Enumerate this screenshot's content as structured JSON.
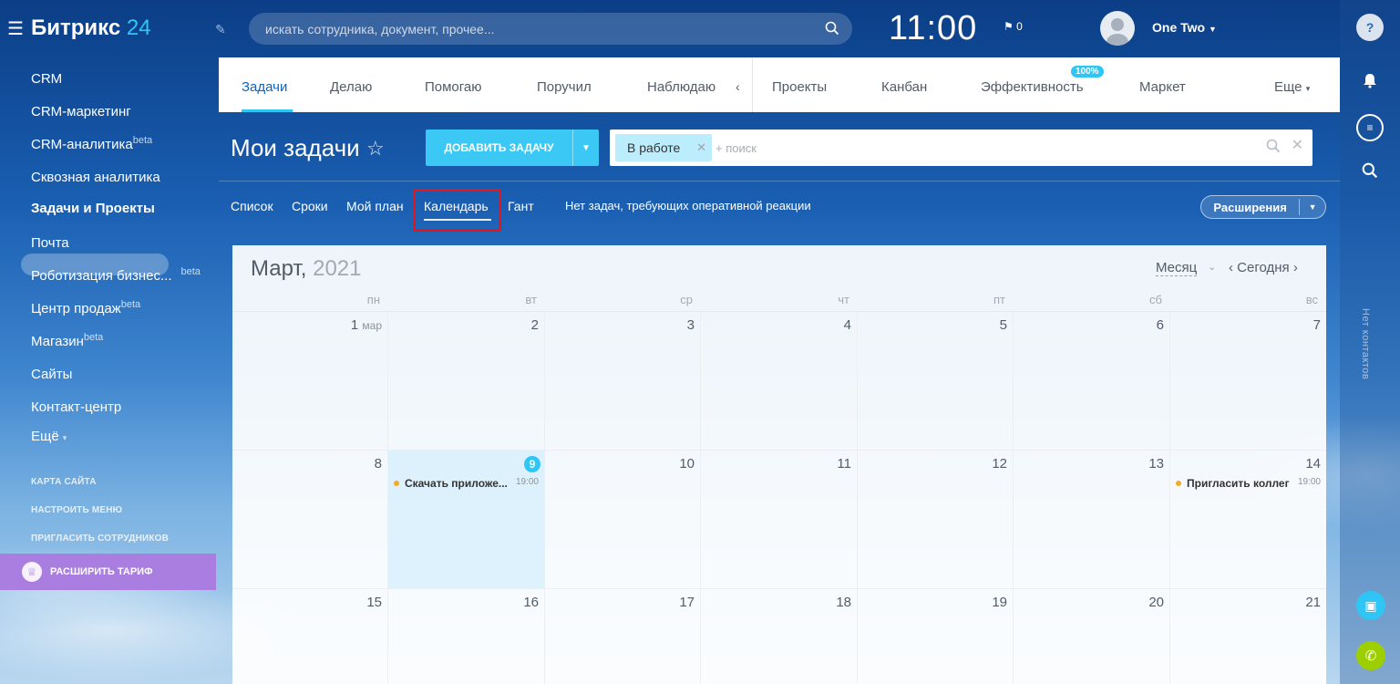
{
  "header": {
    "logo_main": "Битрикс",
    "logo_num": "24",
    "search_placeholder": "искать сотрудника, документ, прочее...",
    "clock": "11:00",
    "flag_count": "0",
    "user_name": "One Two"
  },
  "sidebar": {
    "items": [
      {
        "label": "CRM",
        "sup": ""
      },
      {
        "label": "CRM-маркетинг",
        "sup": ""
      },
      {
        "label": "CRM-аналитика",
        "sup": "beta"
      },
      {
        "label": "Сквозная аналитика",
        "sup": ""
      },
      {
        "label": "Задачи и Проекты",
        "sup": ""
      },
      {
        "label": "Почта",
        "sup": ""
      },
      {
        "label": "Роботизация бизнес...",
        "sup": "beta"
      },
      {
        "label": "Центр продаж",
        "sup": "beta"
      },
      {
        "label": "Магазин",
        "sup": "beta"
      },
      {
        "label": "Сайты",
        "sup": ""
      },
      {
        "label": "Контакт-центр",
        "sup": ""
      },
      {
        "label": "Ещё",
        "sup": ""
      }
    ],
    "links": [
      "Карта сайта",
      "Настроить меню",
      "Пригласить сотрудников"
    ],
    "upgrade_label": "Расширить тариф"
  },
  "tabs": {
    "items": [
      "Задачи",
      "Делаю",
      "Помогаю",
      "Поручил",
      "Наблюдаю",
      "Проекты",
      "Канбан",
      "Эффективность",
      "Маркет",
      "Еще"
    ],
    "badge": "100%"
  },
  "page": {
    "title": "Мои задачи",
    "add_button": "Добавить задачу",
    "filter_chip": "В работе",
    "filter_placeholder": "+ поиск"
  },
  "views": {
    "items": [
      "Список",
      "Сроки",
      "Мой план",
      "Календарь",
      "Гант"
    ],
    "active": "Календарь",
    "counter_text": "Нет задач, требующих оперативной реакции",
    "extensions": "Расширения"
  },
  "calendar": {
    "month": "Март,",
    "year": "2021",
    "view_select": "Месяц",
    "today_label": "Сегодня",
    "weekdays": [
      "пн",
      "вт",
      "ср",
      "чт",
      "пт",
      "сб",
      "вс"
    ],
    "weeks": [
      [
        "1",
        "2",
        "3",
        "4",
        "5",
        "6",
        "7"
      ],
      [
        "8",
        "9",
        "10",
        "11",
        "12",
        "13",
        "14"
      ],
      [
        "15",
        "16",
        "17",
        "18",
        "19",
        "20",
        "21"
      ]
    ],
    "first_day_month": "мар",
    "today_day": "9",
    "events": [
      {
        "day": "9",
        "name": "Скачать приложе...",
        "time": "19:00"
      },
      {
        "day": "14",
        "name": "Пригласить коллег",
        "time": "19:00"
      }
    ]
  },
  "rail": {
    "vertical_text": "Нет контактов"
  },
  "colors": {
    "accent": "#2fc6f6",
    "add_button": "#3bc8f5",
    "upgrade": "#a97ee0",
    "highlight": "#e0171e",
    "event_dot": "#f4a928"
  }
}
